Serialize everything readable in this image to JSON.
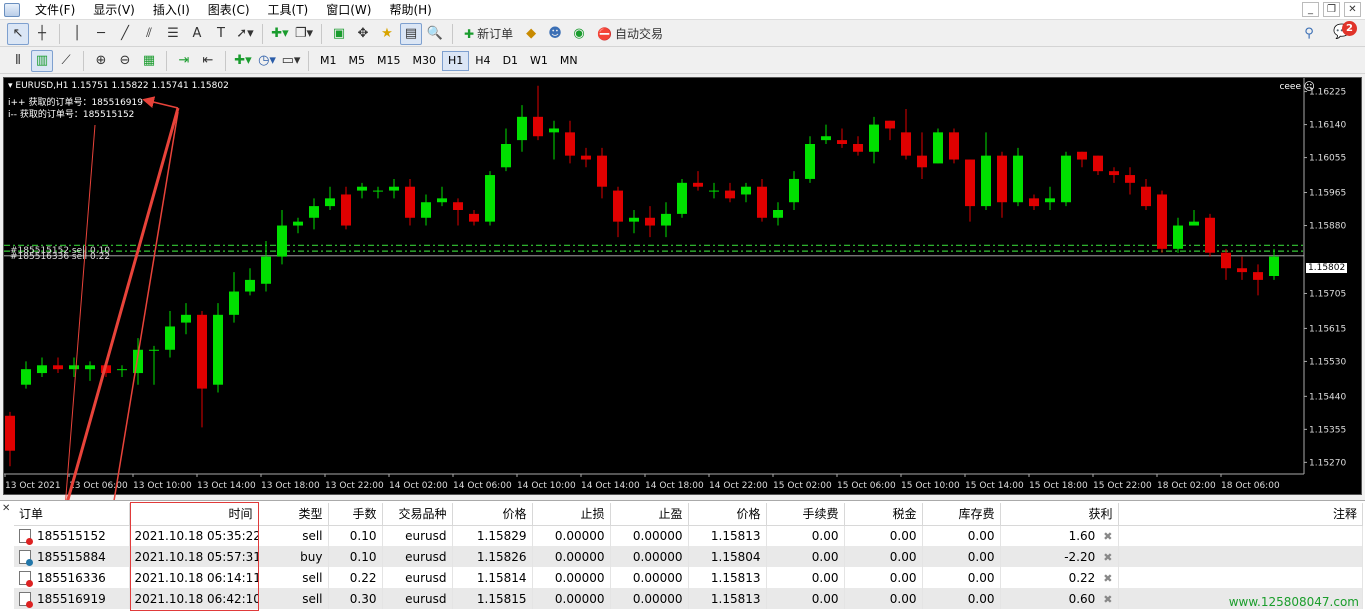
{
  "menu": [
    "文件(F)",
    "显示(V)",
    "插入(I)",
    "图表(C)",
    "工具(T)",
    "窗口(W)",
    "帮助(H)"
  ],
  "toolbar": {
    "new_order": "新订单",
    "auto_trade": "自动交易",
    "notification_count": "2",
    "timeframes": [
      "M1",
      "M5",
      "M15",
      "M30",
      "H1",
      "H4",
      "D1",
      "W1",
      "MN"
    ],
    "active_timeframe": "H1"
  },
  "chart": {
    "header": "EURUSD,H1  1.15751 1.15822 1.15741 1.15802",
    "comment_line1": "i++ 获取的订单号：185516919",
    "comment_line2": "i-- 获取的订单号：185515152",
    "ea_name": "ceee",
    "order_label1": "#185515152 sell 0.10",
    "order_label2": "#185516336 sell 0.22",
    "current_price": "1.15802",
    "price_labels": [
      "1.16225",
      "1.16140",
      "1.16055",
      "1.15965",
      "1.15880",
      "1.15705",
      "1.15615",
      "1.15530",
      "1.15440",
      "1.15355",
      "1.15270"
    ],
    "time_labels": [
      "13 Oct 2021",
      "13 Oct 06:00",
      "13 Oct 10:00",
      "13 Oct 14:00",
      "13 Oct 18:00",
      "13 Oct 22:00",
      "14 Oct 02:00",
      "14 Oct 06:00",
      "14 Oct 10:00",
      "14 Oct 14:00",
      "14 Oct 18:00",
      "14 Oct 22:00",
      "15 Oct 02:00",
      "15 Oct 06:00",
      "15 Oct 10:00",
      "15 Oct 14:00",
      "15 Oct 18:00",
      "15 Oct 22:00",
      "18 Oct 02:00",
      "18 Oct 06:00"
    ],
    "colors": {
      "bull": "#00e000",
      "bear": "#e00000",
      "background": "#000000",
      "order_line": "#35c935"
    },
    "candles": [
      [
        1.1539,
        1.153,
        1.154,
        1.1526
      ],
      [
        1.1547,
        1.1551,
        1.1553,
        1.1546
      ],
      [
        1.155,
        1.1552,
        1.1554,
        1.1549
      ],
      [
        1.1552,
        1.1551,
        1.1554,
        1.155
      ],
      [
        1.1551,
        1.1552,
        1.1554,
        1.1549
      ],
      [
        1.1551,
        1.1552,
        1.1553,
        1.1548
      ],
      [
        1.1552,
        1.155,
        1.1553,
        1.1549
      ],
      [
        1.1551,
        1.1551,
        1.1552,
        1.1549
      ],
      [
        1.155,
        1.1556,
        1.1559,
        1.1547
      ],
      [
        1.1556,
        1.1556,
        1.1557,
        1.1547
      ],
      [
        1.1556,
        1.1562,
        1.1566,
        1.1554
      ],
      [
        1.1563,
        1.1565,
        1.1568,
        1.156
      ],
      [
        1.1565,
        1.1546,
        1.1566,
        1.1536
      ],
      [
        1.1547,
        1.1565,
        1.1568,
        1.1545
      ],
      [
        1.1565,
        1.1571,
        1.1576,
        1.1563
      ],
      [
        1.1571,
        1.1574,
        1.1577,
        1.157
      ],
      [
        1.1573,
        1.158,
        1.1584,
        1.1571
      ],
      [
        1.158,
        1.1588,
        1.1592,
        1.1578
      ],
      [
        1.1588,
        1.1589,
        1.159,
        1.1586
      ],
      [
        1.159,
        1.1593,
        1.1595,
        1.1587
      ],
      [
        1.1593,
        1.1595,
        1.1598,
        1.1592
      ],
      [
        1.1596,
        1.1588,
        1.1598,
        1.1587
      ],
      [
        1.1597,
        1.1598,
        1.1599,
        1.1595
      ],
      [
        1.1597,
        1.1597,
        1.1598,
        1.1595
      ],
      [
        1.1597,
        1.1598,
        1.16,
        1.1595
      ],
      [
        1.1598,
        1.159,
        1.16,
        1.1588
      ],
      [
        1.159,
        1.1594,
        1.1596,
        1.1588
      ],
      [
        1.1594,
        1.1595,
        1.1598,
        1.1593
      ],
      [
        1.1594,
        1.1592,
        1.1595,
        1.1588
      ],
      [
        1.1591,
        1.1589,
        1.1592,
        1.1588
      ],
      [
        1.1589,
        1.1601,
        1.1602,
        1.1588
      ],
      [
        1.1603,
        1.1609,
        1.1613,
        1.1602
      ],
      [
        1.161,
        1.1616,
        1.1619,
        1.1607
      ],
      [
        1.1616,
        1.1611,
        1.1624,
        1.161
      ],
      [
        1.1612,
        1.1613,
        1.1615,
        1.1605
      ],
      [
        1.1612,
        1.1606,
        1.1615,
        1.1604
      ],
      [
        1.1606,
        1.1605,
        1.1608,
        1.1603
      ],
      [
        1.1606,
        1.1598,
        1.1608,
        1.1595
      ],
      [
        1.1597,
        1.1589,
        1.1598,
        1.1585
      ],
      [
        1.1589,
        1.159,
        1.1592,
        1.1586
      ],
      [
        1.159,
        1.1588,
        1.1593,
        1.1585
      ],
      [
        1.1588,
        1.1591,
        1.1594,
        1.1585
      ],
      [
        1.1591,
        1.1599,
        1.16,
        1.159
      ],
      [
        1.1599,
        1.1598,
        1.1602,
        1.1597
      ],
      [
        1.1597,
        1.1597,
        1.1599,
        1.1595
      ],
      [
        1.1597,
        1.1595,
        1.1599,
        1.1594
      ],
      [
        1.1596,
        1.1598,
        1.1599,
        1.1594
      ],
      [
        1.1598,
        1.159,
        1.16,
        1.1589
      ],
      [
        1.159,
        1.1592,
        1.1594,
        1.1588
      ],
      [
        1.1594,
        1.16,
        1.1602,
        1.1592
      ],
      [
        1.16,
        1.1609,
        1.1611,
        1.1599
      ],
      [
        1.161,
        1.1611,
        1.1614,
        1.1609
      ],
      [
        1.161,
        1.1609,
        1.1613,
        1.1608
      ],
      [
        1.1609,
        1.1607,
        1.1611,
        1.1606
      ],
      [
        1.1607,
        1.1614,
        1.1616,
        1.1604
      ],
      [
        1.1615,
        1.1613,
        1.1615,
        1.161
      ],
      [
        1.1612,
        1.1606,
        1.1618,
        1.1605
      ],
      [
        1.1606,
        1.1603,
        1.1612,
        1.16
      ],
      [
        1.1604,
        1.1612,
        1.1613,
        1.1604
      ],
      [
        1.1612,
        1.1605,
        1.1613,
        1.1604
      ],
      [
        1.1605,
        1.1593,
        1.1605,
        1.1589
      ],
      [
        1.1593,
        1.1606,
        1.1612,
        1.1592
      ],
      [
        1.1606,
        1.1594,
        1.1607,
        1.159
      ],
      [
        1.1594,
        1.1606,
        1.1608,
        1.1593
      ],
      [
        1.1595,
        1.1593,
        1.1596,
        1.1592
      ],
      [
        1.1594,
        1.1595,
        1.1598,
        1.1592
      ],
      [
        1.1594,
        1.1606,
        1.1607,
        1.1593
      ],
      [
        1.1607,
        1.1605,
        1.1607,
        1.1603
      ],
      [
        1.1606,
        1.1602,
        1.1606,
        1.1601
      ],
      [
        1.1602,
        1.1601,
        1.1603,
        1.1599
      ],
      [
        1.1601,
        1.1599,
        1.1603,
        1.1596
      ],
      [
        1.1598,
        1.1593,
        1.16,
        1.1592
      ],
      [
        1.1596,
        1.1582,
        1.1597,
        1.1581
      ],
      [
        1.1582,
        1.1588,
        1.159,
        1.1581
      ],
      [
        1.1588,
        1.1589,
        1.1592,
        1.1588
      ],
      [
        1.159,
        1.1581,
        1.1591,
        1.158
      ],
      [
        1.1581,
        1.1577,
        1.1582,
        1.1574
      ],
      [
        1.1577,
        1.1576,
        1.158,
        1.1574
      ],
      [
        1.1576,
        1.1574,
        1.1578,
        1.157
      ],
      [
        1.1575,
        1.158,
        1.1582,
        1.1574
      ]
    ]
  },
  "terminal": {
    "columns": [
      "订单",
      "时间",
      "类型",
      "手数",
      "交易品种",
      "价格",
      "止损",
      "止盈",
      "价格",
      "手续费",
      "税金",
      "库存费",
      "获利",
      "注释"
    ],
    "rows": [
      {
        "order": "185515152",
        "time": "2021.10.18 05:35:22",
        "type": "sell",
        "lots": "0.10",
        "symbol": "eurusd",
        "price": "1.15829",
        "sl": "0.00000",
        "tp": "0.00000",
        "cur_price": "1.15813",
        "commission": "0.00",
        "tax": "0.00",
        "swap": "0.00",
        "profit": "1.60",
        "comment": ""
      },
      {
        "order": "185515884",
        "time": "2021.10.18 05:57:31",
        "type": "buy",
        "lots": "0.10",
        "symbol": "eurusd",
        "price": "1.15826",
        "sl": "0.00000",
        "tp": "0.00000",
        "cur_price": "1.15804",
        "commission": "0.00",
        "tax": "0.00",
        "swap": "0.00",
        "profit": "-2.20",
        "comment": ""
      },
      {
        "order": "185516336",
        "time": "2021.10.18 06:14:11",
        "type": "sell",
        "lots": "0.22",
        "symbol": "eurusd",
        "price": "1.15814",
        "sl": "0.00000",
        "tp": "0.00000",
        "cur_price": "1.15813",
        "commission": "0.00",
        "tax": "0.00",
        "swap": "0.00",
        "profit": "0.22",
        "comment": ""
      },
      {
        "order": "185516919",
        "time": "2021.10.18 06:42:10",
        "type": "sell",
        "lots": "0.30",
        "symbol": "eurusd",
        "price": "1.15815",
        "sl": "0.00000",
        "tp": "0.00000",
        "cur_price": "1.15813",
        "commission": "0.00",
        "tax": "0.00",
        "swap": "0.00",
        "profit": "0.60",
        "comment": ""
      }
    ]
  },
  "watermark": "www.125808047.com"
}
